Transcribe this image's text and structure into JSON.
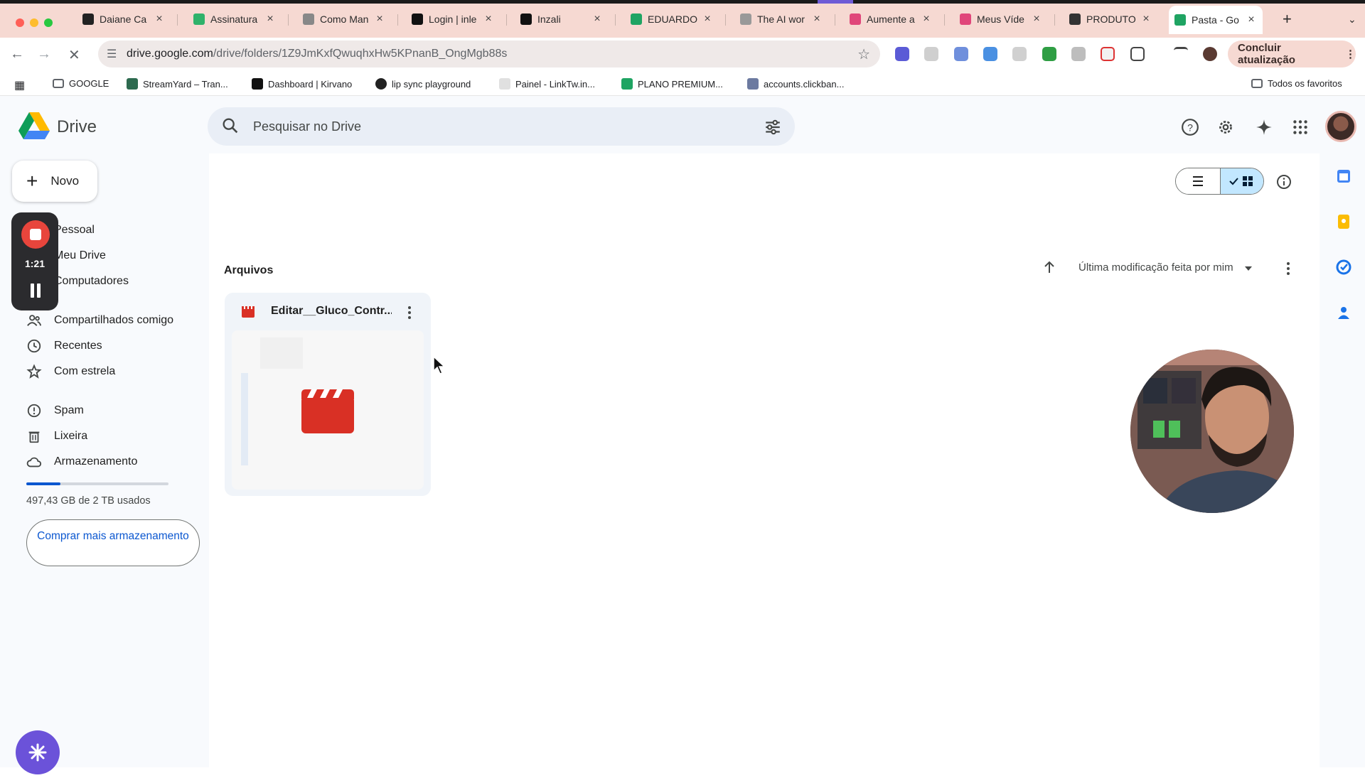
{
  "browser": {
    "tabs": [
      {
        "label": "Daiane Ca",
        "favicon": "#222222"
      },
      {
        "label": "Assinatura",
        "favicon": "#2fb26a"
      },
      {
        "label": "Como Man",
        "favicon": "#888888"
      },
      {
        "label": "Login | inle",
        "favicon": "#111111"
      },
      {
        "label": "Inzali",
        "favicon": "#111111"
      },
      {
        "label": "EDUARDO",
        "favicon": "#1fa463"
      },
      {
        "label": "The AI wor",
        "favicon": "#999999"
      },
      {
        "label": "Aumente a",
        "favicon": "#e0467a"
      },
      {
        "label": "Meus Víde",
        "favicon": "#e0467a"
      },
      {
        "label": "PRODUTO",
        "favicon": "#333333"
      },
      {
        "label": "Pasta - Go",
        "favicon": "#1fa463"
      }
    ],
    "new_tab": "+",
    "url_host": "drive.google.com",
    "url_path": "/drive/folders/1Z9JmKxfQwuqhxHw5KPnanB_OngMgb88s",
    "update_button": "Concluir atualização",
    "bookmarks": [
      {
        "label": "GOOGLE",
        "icon": "folder-icon"
      },
      {
        "label": "StreamYard – Tran...",
        "icon": "streamyard-icon"
      },
      {
        "label": "Dashboard | Kirvano",
        "icon": "kirvano-icon"
      },
      {
        "label": "lip sync playground",
        "icon": "sync-icon"
      },
      {
        "label": "Painel - LinkTw.in...",
        "icon": "linktw-icon"
      },
      {
        "label": "PLANO PREMIUM...",
        "icon": "sheets-icon"
      },
      {
        "label": "accounts.clickban...",
        "icon": "clickbank-icon"
      }
    ],
    "all_bookmarks": "Todos os favoritos"
  },
  "drive": {
    "app_name": "Drive",
    "search_placeholder": "Pesquisar no Drive",
    "new_button": "Novo",
    "nav": [
      {
        "label": "Pessoal",
        "icon": "home-icon"
      },
      {
        "label": "Meu Drive",
        "icon": "drive-icon"
      },
      {
        "label": "Computadores",
        "icon": "computer-icon"
      },
      {
        "label": "Compartilhados comigo",
        "icon": "people-icon"
      },
      {
        "label": "Recentes",
        "icon": "clock-icon"
      },
      {
        "label": "Com estrela",
        "icon": "star-icon"
      },
      {
        "label": "Spam",
        "icon": "spam-icon"
      },
      {
        "label": "Lixeira",
        "icon": "trash-icon"
      },
      {
        "label": "Armazenamento",
        "icon": "cloud-icon"
      }
    ],
    "storage_used_fraction": 0.24,
    "storage_text": "497,43 GB de 2 TB usados",
    "buy_storage": "Comprar mais armazenamento",
    "files_label": "Arquivos",
    "sort_label": "Última modificação feita por mim",
    "files": [
      {
        "name": "Editar__Gluco_Contr...",
        "type": "video"
      }
    ],
    "accent_color": "#0b57d0"
  },
  "recorder": {
    "time": "1:21"
  }
}
